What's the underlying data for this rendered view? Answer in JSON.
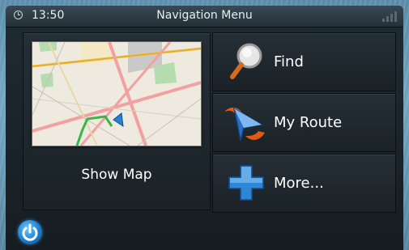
{
  "statusbar": {
    "time": "13:50",
    "title": "Navigation Menu",
    "clock_icon": "clock-icon",
    "signal_icon": "signal-bars-icon"
  },
  "map_tile": {
    "label": "Show Map"
  },
  "menu": {
    "items": [
      {
        "label": "Find",
        "icon": "magnifier-icon"
      },
      {
        "label": "My Route",
        "icon": "route-arrow-icon"
      },
      {
        "label": "More...",
        "icon": "plus-icon"
      }
    ]
  },
  "footer": {
    "power_icon": "power-icon"
  },
  "colors": {
    "background": "#6b99b5",
    "panel": "#1a2227",
    "accent_blue": "#1b7fd1",
    "route_green": "#39b54a"
  }
}
